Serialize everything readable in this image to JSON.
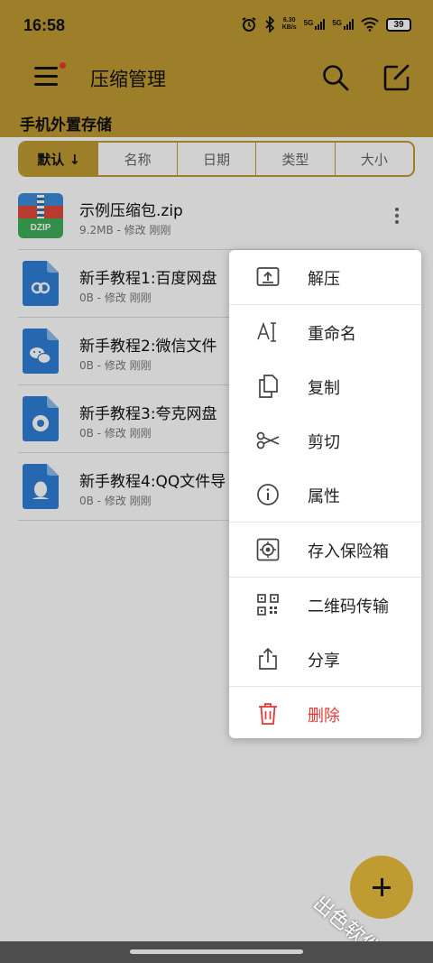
{
  "status_bar": {
    "time": "16:58",
    "net_speed_value": "6.30",
    "net_speed_unit": "KB/s",
    "sim1_tag": "5G",
    "sim2_tag": "5G",
    "battery": "39"
  },
  "app_bar": {
    "title": "压缩管理",
    "icons": [
      "menu-icon",
      "search-icon",
      "edit-icon"
    ]
  },
  "storage_label": "手机外置存储",
  "sort_tabs": [
    {
      "label": "默认 ↓",
      "active": true
    },
    {
      "label": "名称",
      "active": false
    },
    {
      "label": "日期",
      "active": false
    },
    {
      "label": "类型",
      "active": false
    },
    {
      "label": "大小",
      "active": false
    }
  ],
  "files": [
    {
      "name": "示例压缩包.zip",
      "meta": "9.2MB - 修改 刚刚",
      "icon": "dzip-icon",
      "icon_label": "DZIP"
    },
    {
      "name": "新手教程1:百度网盘",
      "meta": "0B - 修改 刚刚",
      "icon": "baidu-doc-icon"
    },
    {
      "name": "新手教程2:微信文件",
      "meta": "0B - 修改 刚刚",
      "icon": "wechat-doc-icon"
    },
    {
      "name": "新手教程3:夸克网盘",
      "meta": "0B - 修改 刚刚",
      "icon": "quark-doc-icon"
    },
    {
      "name": "新手教程4:QQ文件导",
      "meta": "0B - 修改 刚刚",
      "icon": "qq-doc-icon"
    }
  ],
  "context_menu": {
    "items": [
      {
        "label": "解压",
        "icon": "extract-icon"
      },
      {
        "label": "重命名",
        "icon": "rename-icon"
      },
      {
        "label": "复制",
        "icon": "copy-icon"
      },
      {
        "label": "剪切",
        "icon": "scissors-icon"
      },
      {
        "label": "属性",
        "icon": "info-icon"
      },
      {
        "label": "存入保险箱",
        "icon": "safe-icon"
      },
      {
        "label": "二维码传输",
        "icon": "qrcode-icon"
      },
      {
        "label": "分享",
        "icon": "share-icon"
      },
      {
        "label": "删除",
        "icon": "trash-icon"
      }
    ]
  },
  "fab": {
    "icon": "plus-icon"
  },
  "watermark": "出色软件站",
  "colors": {
    "accent": "#c09b32",
    "danger": "#e53935",
    "dzip_blue": "#3a8ed8",
    "dzip_red": "#e04a3a",
    "dzip_green": "#3fae5a",
    "doc_blue": "#2f7fd6"
  }
}
